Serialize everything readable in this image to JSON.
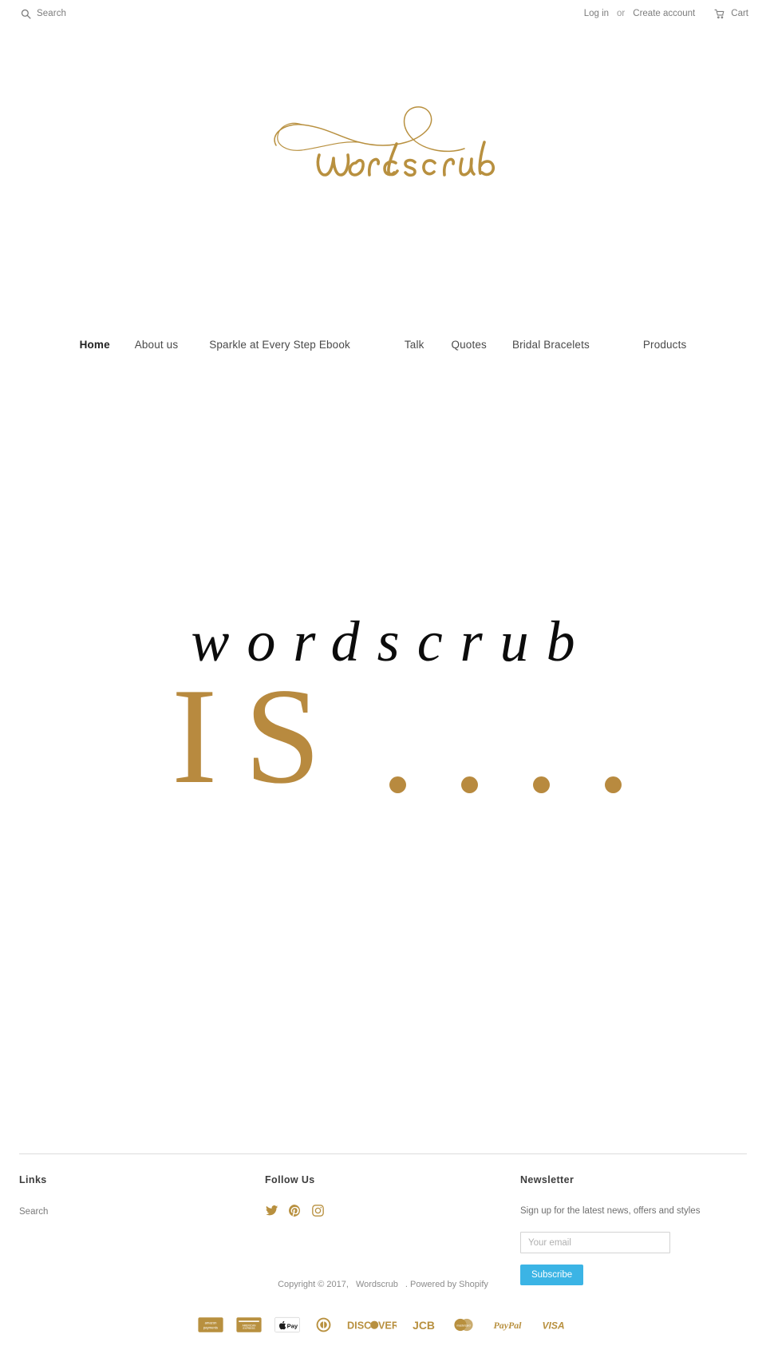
{
  "topbar": {
    "search_label": "Search",
    "search_icon": "search-icon",
    "login_label": "Log in",
    "or_label": "or",
    "create_account_label": "Create account",
    "cart_label": "Cart",
    "cart_icon": "cart-icon"
  },
  "logo": {
    "text": "wordscrub",
    "color": "#b8903f"
  },
  "nav": {
    "items": [
      {
        "label": "Home",
        "active": true
      },
      {
        "label": "About us",
        "active": false
      },
      {
        "label": "Sparkle at Every Step Ebook",
        "active": false
      },
      {
        "label": "Talk",
        "active": false
      },
      {
        "label": "Quotes",
        "active": false
      },
      {
        "label": "Bridal Bracelets",
        "active": false
      },
      {
        "label": "Products",
        "active": false
      }
    ]
  },
  "hero": {
    "word": "wordscrub",
    "is": "IS",
    "dots_count": 4,
    "word_color": "#0c0c0c",
    "accent_color": "#b88a3f"
  },
  "footer": {
    "links": {
      "title": "Links",
      "items": [
        {
          "label": "Search"
        }
      ]
    },
    "follow": {
      "title": "Follow Us",
      "socials": [
        {
          "name": "twitter-icon"
        },
        {
          "name": "pinterest-icon"
        },
        {
          "name": "instagram-icon"
        }
      ]
    },
    "newsletter": {
      "title": "Newsletter",
      "description": "Sign up for the latest news, offers and styles",
      "email_value": "",
      "email_placeholder": "Your email",
      "subscribe_label": "Subscribe",
      "button_color": "#3bb4e5"
    }
  },
  "copyright": {
    "prefix": "Copyright © 2017,",
    "shop_name": "Wordscrub",
    "suffix": ". Powered by Shopify"
  },
  "payments": [
    {
      "name": "amazon-payments-icon",
      "label": "amazon payments"
    },
    {
      "name": "american-express-icon",
      "label": "AMERICAN EXPRESS"
    },
    {
      "name": "apple-pay-icon",
      "label": "Pay"
    },
    {
      "name": "diners-club-icon",
      "label": "Diners Club"
    },
    {
      "name": "discover-icon",
      "label": "DISCOVER"
    },
    {
      "name": "jcb-icon",
      "label": "JCB"
    },
    {
      "name": "master-icon",
      "label": "mastercard"
    },
    {
      "name": "paypal-icon",
      "label": "PayPal"
    },
    {
      "name": "visa-icon",
      "label": "VISA"
    }
  ]
}
